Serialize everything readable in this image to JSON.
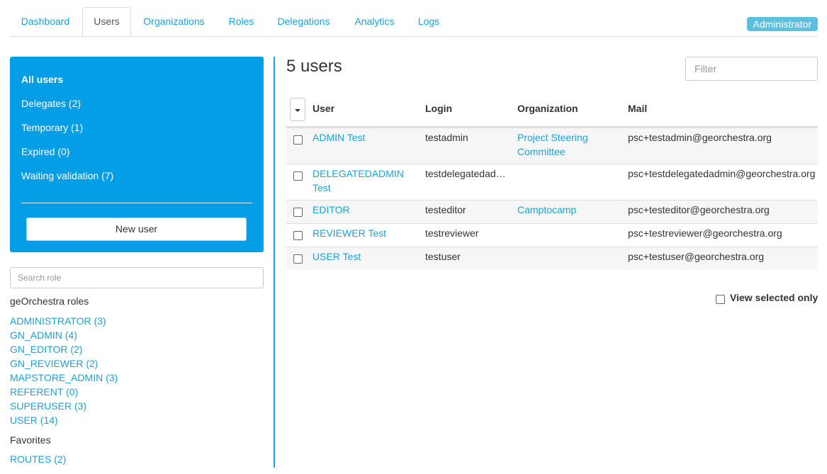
{
  "tabs": [
    {
      "label": "Dashboard"
    },
    {
      "label": "Users"
    },
    {
      "label": "Organizations"
    },
    {
      "label": "Roles"
    },
    {
      "label": "Delegations"
    },
    {
      "label": "Analytics"
    },
    {
      "label": "Logs"
    }
  ],
  "active_tab": "Users",
  "user_role_badge": "Administrator",
  "sidebar": {
    "items": [
      {
        "label": "All users"
      },
      {
        "label": "Delegates (2)"
      },
      {
        "label": "Temporary (1)"
      },
      {
        "label": "Expired (0)"
      },
      {
        "label": "Waiting validation (7)"
      }
    ],
    "new_user_label": "New user",
    "search_placeholder": "Search role",
    "roles_heading": "geOrchestra roles",
    "roles": [
      {
        "label": "ADMINISTRATOR (3)"
      },
      {
        "label": "GN_ADMIN (4)"
      },
      {
        "label": "GN_EDITOR (2)"
      },
      {
        "label": "GN_REVIEWER (2)"
      },
      {
        "label": "MAPSTORE_ADMIN (3)"
      },
      {
        "label": "REFERENT (0)"
      },
      {
        "label": "SUPERUSER (3)"
      },
      {
        "label": "USER (14)"
      }
    ],
    "favorites_heading": "Favorites",
    "favorites": [
      {
        "label": "ROUTES (2)"
      }
    ]
  },
  "main": {
    "title": "5 users",
    "filter_placeholder": "Filter",
    "columns": {
      "user": "User",
      "login": "Login",
      "organization": "Organization",
      "mail": "Mail"
    },
    "rows": [
      {
        "user": "ADMIN Test",
        "login": "testadmin",
        "organization": "Project Steering Committee",
        "mail": "psc+testadmin@georchestra.org"
      },
      {
        "user": "DELEGATEDADMIN Test",
        "login": "testdelegatedad…",
        "organization": "",
        "mail": "psc+testdelegatedadmin@georchestra.org"
      },
      {
        "user": "EDITOR",
        "login": "testeditor",
        "organization": "Camptocamp",
        "mail": "psc+testeditor@georchestra.org"
      },
      {
        "user": "REVIEWER Test",
        "login": "testreviewer",
        "organization": "",
        "mail": "psc+testreviewer@georchestra.org"
      },
      {
        "user": "USER Test",
        "login": "testuser",
        "organization": "",
        "mail": "psc+testuser@georchestra.org"
      }
    ],
    "view_selected_label": "View selected only"
  },
  "colors": {
    "accent": "#1aa3d9",
    "sidebar_bg": "#049ee6",
    "badge": "#5bc0de"
  }
}
